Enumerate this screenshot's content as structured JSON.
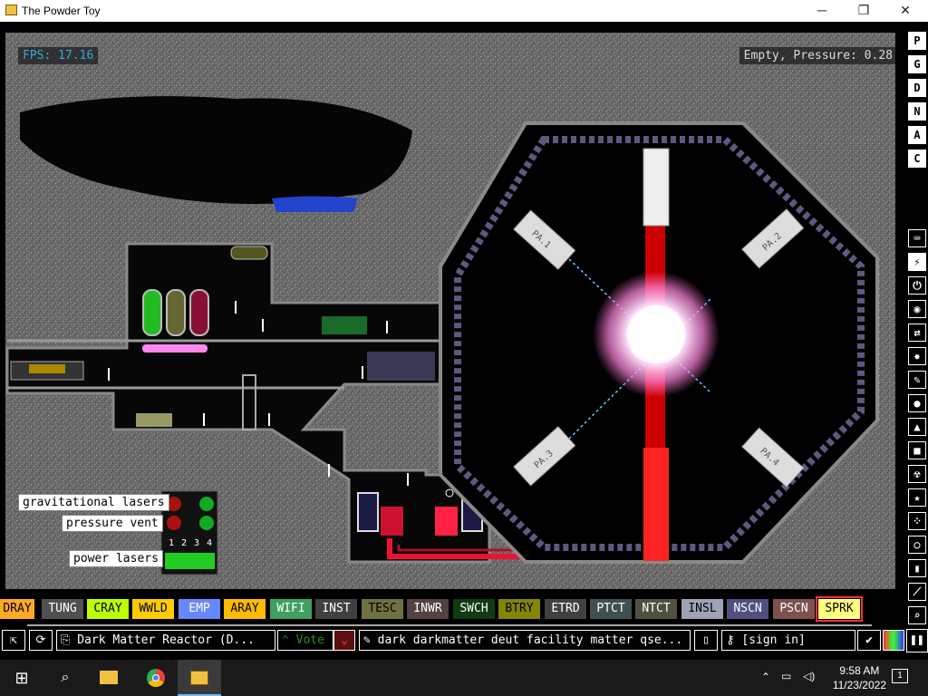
{
  "window": {
    "title": "The Powder Toy",
    "minimize": "─",
    "maximize": "❐",
    "close": "✕"
  },
  "hud": {
    "fps": "FPS: 17.16",
    "pressure": "Empty, Pressure: 0.28"
  },
  "labels": {
    "gravitational_lasers": "gravitational lasers",
    "pressure_vent": "pressure vent",
    "power_lasers": "power lasers"
  },
  "reactor": {
    "pa1": "PA.1",
    "pa2": "PA.2",
    "pa3": "PA.3",
    "pa4": "PA.4"
  },
  "panel_numbers": [
    "1",
    "2",
    "3",
    "4"
  ],
  "right_menu": [
    "P",
    "G",
    "D",
    "N",
    "A",
    "C"
  ],
  "right_tools": [
    "keyboard-icon",
    "plug-icon",
    "power-icon",
    "sensor-icon",
    "arrows-icon",
    "explosive-icon",
    "pencil-icon",
    "drop-icon",
    "flask-icon",
    "box-icon",
    "radiation-icon",
    "star-icon",
    "dots-icon",
    "bulb-icon",
    "bookmark-icon",
    "wand-icon",
    "magnifier-icon"
  ],
  "elements": [
    {
      "name": "DRAY",
      "bg": "#ffaa22",
      "fg": "#000000"
    },
    {
      "name": "TUNG",
      "bg": "#505050",
      "fg": "#ffffff"
    },
    {
      "name": "CRAY",
      "bg": "#bbff00",
      "fg": "#000000"
    },
    {
      "name": "WWLD",
      "bg": "#ffcc00",
      "fg": "#000000"
    },
    {
      "name": "EMP",
      "bg": "#6688ff",
      "fg": "#ffffff"
    },
    {
      "name": "ARAY",
      "bg": "#ffbb00",
      "fg": "#000000"
    },
    {
      "name": "WIFI",
      "bg": "#40a060",
      "fg": "#ffffff"
    },
    {
      "name": "INST",
      "bg": "#404040",
      "fg": "#ffffff"
    },
    {
      "name": "TESC",
      "bg": "#707040",
      "fg": "#000000"
    },
    {
      "name": "INWR",
      "bg": "#544141",
      "fg": "#ffffff"
    },
    {
      "name": "SWCH",
      "bg": "#103b11",
      "fg": "#ffffff"
    },
    {
      "name": "BTRY",
      "bg": "#858505",
      "fg": "#000000"
    },
    {
      "name": "ETRD",
      "bg": "#404040",
      "fg": "#ffffff"
    },
    {
      "name": "PTCT",
      "bg": "#405050",
      "fg": "#ffffff"
    },
    {
      "name": "NTCT",
      "bg": "#505040",
      "fg": "#ffffff"
    },
    {
      "name": "INSL",
      "bg": "#9ea3b6",
      "fg": "#000000"
    },
    {
      "name": "NSCN",
      "bg": "#505080",
      "fg": "#ffffff"
    },
    {
      "name": "PSCN",
      "bg": "#805050",
      "fg": "#ffffff"
    },
    {
      "name": "SPRK",
      "bg": "#ffff80",
      "fg": "#000000",
      "selected": true
    }
  ],
  "bottom": {
    "save_title": "Dark Matter Reactor (D...",
    "vote": "Vote",
    "tags": "dark darkmatter deut facility matter qse...",
    "sign_in": "[sign in]"
  },
  "taskbar": {
    "time": "9:58 AM",
    "date": "11/23/2022",
    "notifications": "1"
  },
  "colors": {
    "accent": "#33aadd",
    "vote": "#2a8a2a",
    "laser": "#ff2020",
    "selected_outline": "#ff3333"
  }
}
